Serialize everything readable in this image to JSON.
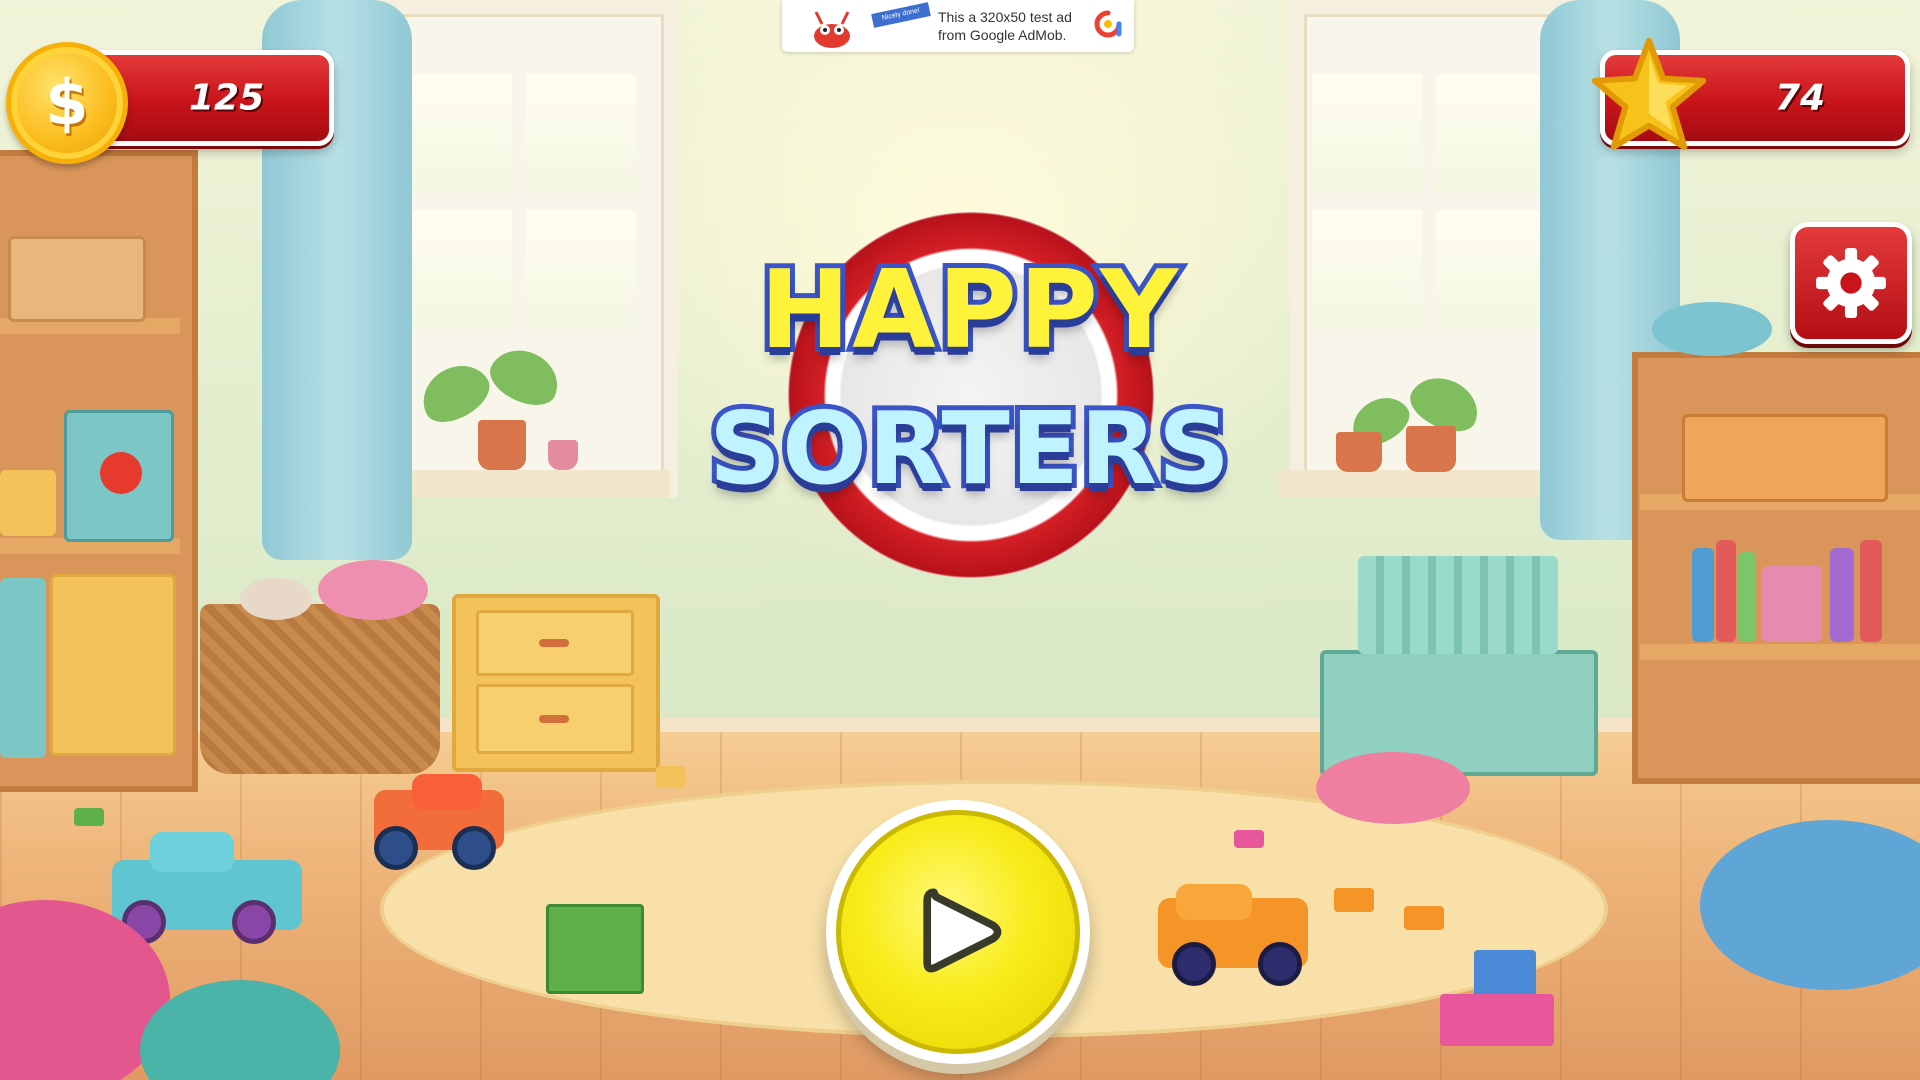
{
  "game": {
    "title_line1": "HAPPY",
    "title_line2": "SORTERS"
  },
  "hud": {
    "coins": {
      "icon": "dollar-coin-icon",
      "symbol": "$",
      "value": "125"
    },
    "stars": {
      "icon": "star-icon",
      "value": "74"
    },
    "settings": {
      "icon": "gear-icon"
    }
  },
  "ad_banner": {
    "text_line1": "This a 320x50 test ad",
    "text_line2": "from Google AdMob.",
    "ribbon": "Nicely done!"
  },
  "play": {
    "icon": "play-icon"
  },
  "colors": {
    "hud_red": "#c8141a",
    "coin_gold": "#fbbd1e",
    "play_yellow": "#f8ec1a",
    "logo_outline": "#3b54c8",
    "logo_happy": "#fff23a",
    "logo_sorters": "#bff3ff"
  }
}
